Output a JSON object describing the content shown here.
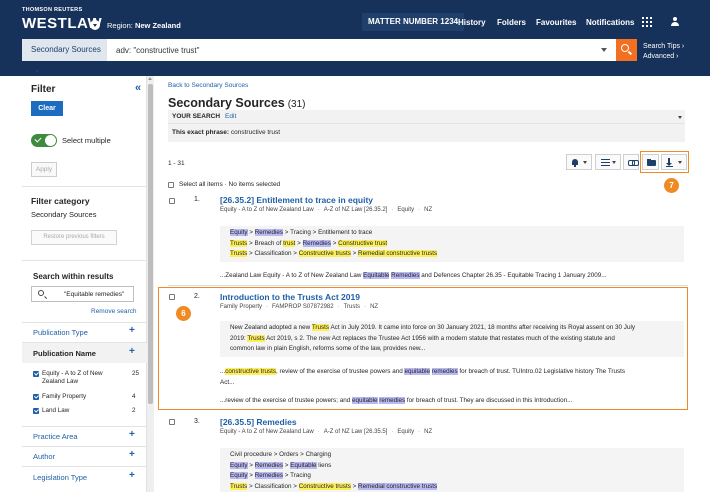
{
  "header": {
    "brand_top": "THOMSON REUTERS",
    "brand_name": "WESTLAW",
    "region_label": "Region:",
    "region_value": "New Zealand",
    "matter": "MATTER NUMBER 1234",
    "nav": [
      "History",
      "Folders",
      "Favourites",
      "Notifications"
    ]
  },
  "search": {
    "source": "Secondary Sources",
    "query": "adv: \"constructive trust\"",
    "tips": "Search Tips ›",
    "advanced": "Advanced ›"
  },
  "sidebar": {
    "title": "Filter",
    "collapse": "«",
    "clear": "Clear",
    "select_multiple": "Select multiple",
    "apply": "Apply",
    "category_heading": "Filter category",
    "category_value": "Secondary Sources",
    "restore": "Restore previous filters",
    "swr_heading": "Search within results",
    "swr_value": "\"Equitable remedies\"",
    "remove_search": "Remove search",
    "publication_type": "Publication Type",
    "publication_name": "Publication Name",
    "publications": [
      {
        "name": "Equity - A to Z of New Zealand Law",
        "count": "25"
      },
      {
        "name": "Family Property",
        "count": "4"
      },
      {
        "name": "Land Law",
        "count": "2"
      }
    ],
    "practice_area": "Practice Area",
    "author": "Author",
    "legislation_type": "Legislation Type",
    "plus": "+"
  },
  "main": {
    "back": "Back to Secondary Sources",
    "title": "Secondary Sources",
    "count": "(31)",
    "your_search": "YOUR SEARCH",
    "edit": "Edit",
    "exact_label": "This exact phrase:",
    "exact_value": "constructive trust",
    "range": "1 - 31",
    "select_all": "Select all items",
    "no_items": "No items selected",
    "sep": "·",
    "badge6": "6",
    "badge7": "7"
  },
  "results": [
    {
      "num": "1.",
      "title": "[26.35.2] Entitlement to trace in equity",
      "meta": [
        "Equity - A to Z of New Zealand Law",
        "A-Z of NZ Law [26.35.2]",
        "Equity",
        "NZ"
      ]
    },
    {
      "num": "2.",
      "title": "Introduction to the Trusts Act 2019",
      "meta": [
        "Family Property",
        "FAMPROP S07872982",
        "Trusts",
        "NZ"
      ]
    },
    {
      "num": "3.",
      "title": "[26.35.5] Remedies",
      "meta": [
        "Equity - A to Z of New Zealand Law",
        "A-Z of NZ Law [26.35.5]",
        "Equity",
        "NZ"
      ]
    }
  ],
  "snippets": {
    "r1_l1": [
      "Equity",
      " > ",
      "Remedies",
      " > Tracing > Entitlement to trace"
    ],
    "r1_l2": [
      "Trusts",
      " > Breach of ",
      "trust",
      " > ",
      "Remedies",
      " > ",
      "Constructive trust"
    ],
    "r1_l3": [
      "Trusts",
      " > Classification > ",
      "Constructive trusts",
      " > ",
      "Remedial constructive trusts"
    ],
    "r1_p1": [
      "...Zealand Law Equity - A to Z of New Zealand Law ",
      "Equitable",
      " ",
      "Remedies",
      " and Defences Chapter 26.35 - Equitable Tracing 1 January 2009..."
    ],
    "r2_a": [
      "New Zealand adopted a new ",
      "Trusts",
      " Act in July 2019. It came into force on 30 January 2021, 18 months after receiving its Royal assent on 30 July"
    ],
    "r2_b": [
      "2019: ",
      "Trusts",
      " Act 2019, s 2. The new Act replaces the Trustee Act 1956 with a modern statute that restates much of the existing statute and"
    ],
    "r2_c": "common law in plain English, reforms some of the law, provides new...",
    "r2_p1": [
      "...",
      "constructive trusts",
      ", review of the exercise of trustee powers and ",
      "equitable",
      " ",
      "remedies",
      " for breach of trust. TUIntro.02 Legislative history The Trusts"
    ],
    "r2_p1b": "Act...",
    "r2_p2": [
      "...review of the exercise of trustee powers; and ",
      "equitable",
      " ",
      "remedies",
      " for breach of trust. They are discussed in this Introduction..."
    ],
    "r3_l1": "Civil procedure > Orders > Charging",
    "r3_l2": [
      "Equity",
      " > ",
      "Remedies",
      " > ",
      "Equitable",
      " liens"
    ],
    "r3_l3": [
      "Equity",
      " > ",
      "Remedies",
      " > Tracing"
    ],
    "r3_l4": [
      "Trusts",
      " > Classification > ",
      "Constructive trusts",
      " > ",
      "Remedial constructive trusts"
    ]
  }
}
